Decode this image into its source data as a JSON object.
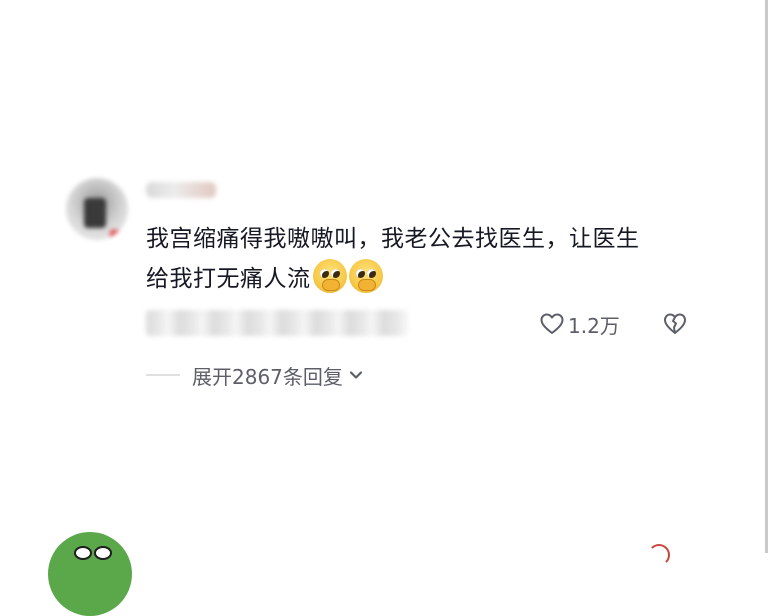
{
  "comment": {
    "text_line1": "我宫缩痛得我嗷嗷叫，我老公去找医生，让医生",
    "text_line2": "给我打无痛人流",
    "emojis": [
      "pleading-face-emoji",
      "pleading-face-emoji"
    ],
    "like_count": "1.2万",
    "expand_replies_label": "展开2867条回复"
  },
  "icons": {
    "like": "heart-outline-icon",
    "dislike": "broken-heart-icon",
    "expand": "chevron-down-icon"
  },
  "colors": {
    "text_primary": "#161823",
    "text_secondary": "#5d5f68",
    "next_avatar": "#5aa84a"
  }
}
